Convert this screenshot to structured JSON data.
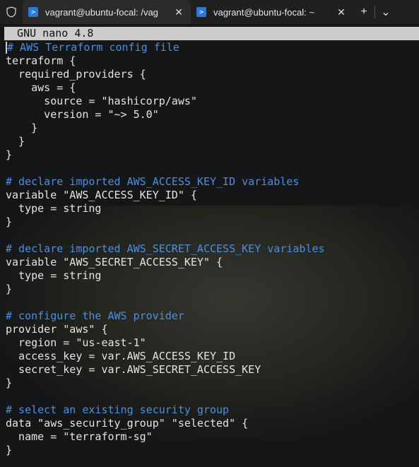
{
  "tabs": [
    {
      "title": "vagrant@ubuntu-focal: /vag",
      "active": true
    },
    {
      "title": "vagrant@ubuntu-focal: ~",
      "active": false
    }
  ],
  "tab_actions": {
    "new_tab": "+",
    "dropdown": "⌄",
    "close": "✕"
  },
  "editor": {
    "header": "  GNU nano 4.8",
    "lines": [
      {
        "text": "# AWS Terraform config file",
        "type": "comment"
      },
      {
        "text": "terraform {",
        "type": "code"
      },
      {
        "text": "  required_providers {",
        "type": "code"
      },
      {
        "text": "    aws = {",
        "type": "code"
      },
      {
        "text": "      source = \"hashicorp/aws\"",
        "type": "code"
      },
      {
        "text": "      version = \"~> 5.0\"",
        "type": "code"
      },
      {
        "text": "    }",
        "type": "code"
      },
      {
        "text": "  }",
        "type": "code"
      },
      {
        "text": "}",
        "type": "code"
      },
      {
        "text": "",
        "type": "code"
      },
      {
        "text": "# declare imported AWS_ACCESS_KEY_ID variables",
        "type": "comment"
      },
      {
        "text": "variable \"AWS_ACCESS_KEY_ID\" {",
        "type": "code"
      },
      {
        "text": "  type = string",
        "type": "code"
      },
      {
        "text": "}",
        "type": "code"
      },
      {
        "text": "",
        "type": "code"
      },
      {
        "text": "# declare imported AWS_SECRET_ACCESS_KEY variables",
        "type": "comment"
      },
      {
        "text": "variable \"AWS_SECRET_ACCESS_KEY\" {",
        "type": "code"
      },
      {
        "text": "  type = string",
        "type": "code"
      },
      {
        "text": "}",
        "type": "code"
      },
      {
        "text": "",
        "type": "code"
      },
      {
        "text": "# configure the AWS provider",
        "type": "comment"
      },
      {
        "text": "provider \"aws\" {",
        "type": "code"
      },
      {
        "text": "  region = \"us-east-1\"",
        "type": "code"
      },
      {
        "text": "  access_key = var.AWS_ACCESS_KEY_ID",
        "type": "code"
      },
      {
        "text": "  secret_key = var.AWS_SECRET_ACCESS_KEY",
        "type": "code"
      },
      {
        "text": "}",
        "type": "code"
      },
      {
        "text": "",
        "type": "code"
      },
      {
        "text": "# select an existing security group",
        "type": "comment"
      },
      {
        "text": "data \"aws_security_group\" \"selected\" {",
        "type": "code"
      },
      {
        "text": "  name = \"terraform-sg\"",
        "type": "code"
      },
      {
        "text": "}",
        "type": "code"
      }
    ]
  },
  "colors": {
    "comment": "#4b8fe0",
    "header_bg": "#cccccc",
    "accent": "#2d7ad6"
  }
}
